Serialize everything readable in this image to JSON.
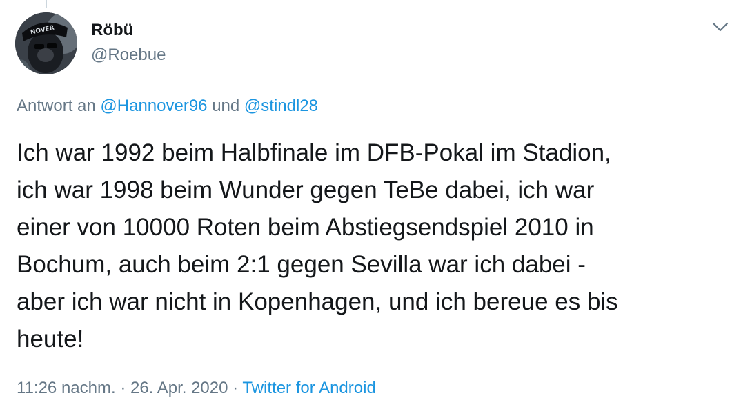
{
  "author": {
    "display_name": "Röbü",
    "handle": "@Roebue",
    "cap_text": "NOVER"
  },
  "reply": {
    "prefix": "Antwort an",
    "mention_1": "@Hannover96",
    "joiner": "und",
    "mention_2": "@stindl28"
  },
  "tweet": {
    "text": "Ich war 1992 beim Halbfinale im DFB-Pokal im Stadion,\nich war 1998 beim Wunder gegen TeBe dabei, ich war\neiner von 10000 Roten beim Abstiegsendspiel 2010 in\nBochum, auch beim 2:1 gegen Sevilla war ich dabei -\naber ich war nicht in Kopenhagen, und ich bereue es bis\nheute!"
  },
  "meta": {
    "time": "11:26 nachm.",
    "separator": "·",
    "date": "26. Apr. 2020",
    "source": "Twitter for Android"
  },
  "icons": {
    "menu": "chevron-down-icon"
  },
  "colors": {
    "link": "#1b95e0",
    "secondary_text": "#657786",
    "primary_text": "#14171a"
  }
}
